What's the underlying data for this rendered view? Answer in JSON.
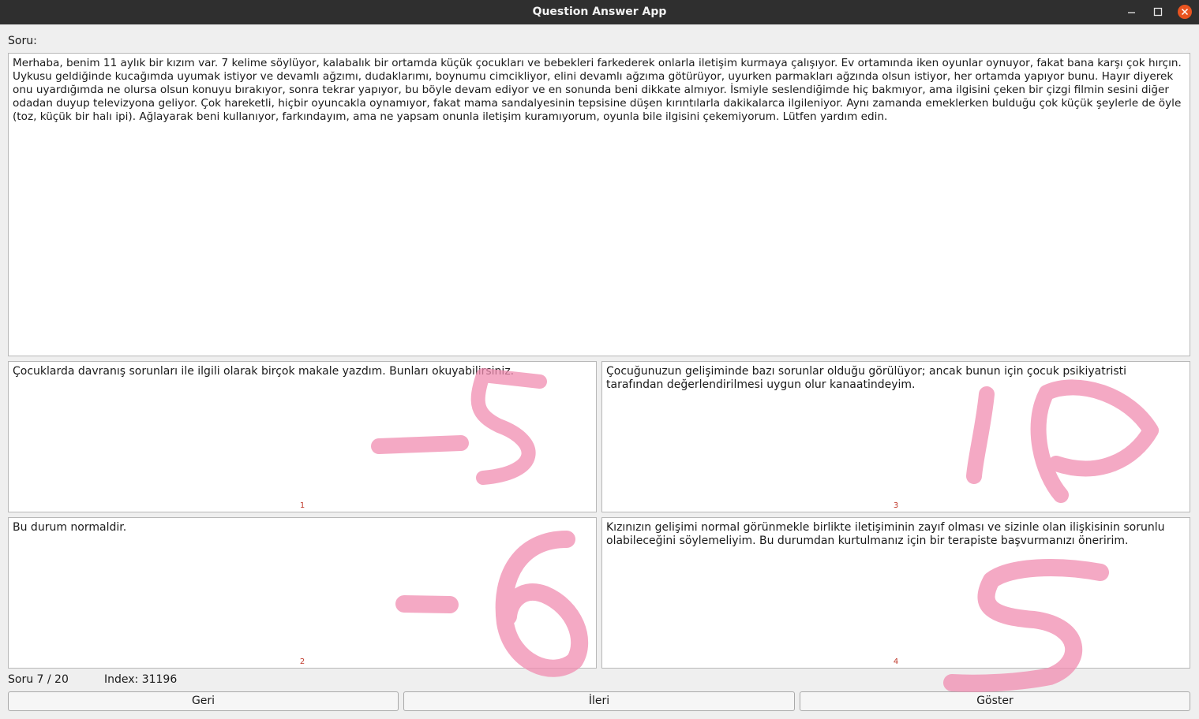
{
  "window": {
    "title": "Question Answer App",
    "minimize_icon": "minimize-icon",
    "maximize_icon": "maximize-icon",
    "close_icon": "close-icon",
    "close_color": "#e95420"
  },
  "question": {
    "label": "Soru:",
    "text": "Merhaba, benim 11 aylık bir kızım var. 7 kelime söylüyor, kalabalık bir ortamda küçük çocukları ve bebekleri farkederek onlarla iletişim kurmaya çalışıyor. Ev ortamında iken oyunlar oynuyor, fakat bana karşı çok hırçın. Uykusu geldiğinde kucağımda uyumak istiyor ve devamlı ağzımı, dudaklarımı, boynumu cimcikliyor, elini devamlı ağzıma götürüyor, uyurken parmakları ağzında olsun istiyor, her ortamda yapıyor bunu. Hayır diyerek onu uyardığımda ne olursa olsun konuyu bırakıyor, sonra tekrar yapıyor, bu böyle devam ediyor ve en sonunda beni dikkate almıyor. İsmiyle seslendiğimde hiç bakmıyor, ama ilgisini çeken bir çizgi filmin sesini diğer odadan duyup televizyona geliyor. Çok hareketli, hiçbir oyuncakla oynamıyor, fakat mama sandalyesinin tepsisine düşen kırıntılarla dakikalarca ilgileniyor. Aynı zamanda emeklerken bulduğu çok küçük şeylerle de öyle (toz, küçük bir halı ipi). Ağlayarak beni kullanıyor, farkındayım, ama ne yapsam onunla iletişim kuramıyorum, oyunla bile ilgisini çekemiyorum. Lütfen yardım edin."
  },
  "answers": [
    {
      "number": "1",
      "text": "Çocuklarda davranış sorunları ile ilgili olarak birçok makale yazdım. Bunları okuyabilirsiniz."
    },
    {
      "number": "2",
      "text": "Bu durum normaldir."
    },
    {
      "number": "3",
      "text": "Çocuğunuzun gelişiminde bazı sorunlar olduğu görülüyor; ancak bunun için çocuk psikiyatristi tarafından değerlendirilmesi uygun olur kanaatindeyim."
    },
    {
      "number": "4",
      "text": "Kızınızın gelişimi normal görünmekle birlikte iletişiminin zayıf olması ve sizinle olan ilişkisinin sorunlu olabileceğini söylemeliyim. Bu durumdan kurtulmanız için bir terapiste başvurmanızı öneririm."
    }
  ],
  "status": {
    "progress": "Soru 7 / 20",
    "index": "Index: 31196"
  },
  "buttons": {
    "back": "Geri",
    "next": "İleri",
    "show": "Göster"
  },
  "annotations": {
    "color": "#f08cb0",
    "answer_1_score": "-5",
    "answer_2_score": "-6",
    "answer_3_score": "10",
    "answer_4_score": "5"
  }
}
